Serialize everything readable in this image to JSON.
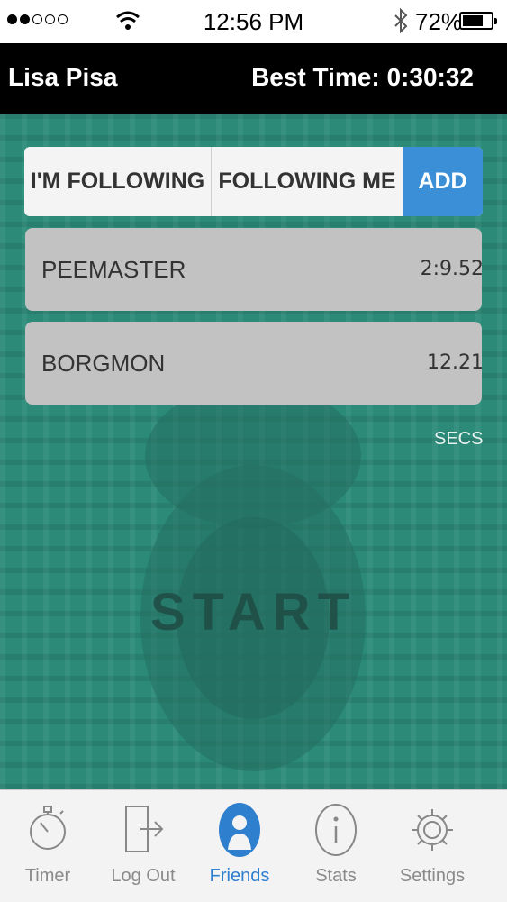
{
  "status_bar": {
    "time": "12:56 PM",
    "battery": "72%",
    "battery_level": 0.72
  },
  "header": {
    "user_name": "Lisa Pisa",
    "best_time": "Best Time: 0:30:32"
  },
  "tabs": {
    "im_following": "I'M FOLLOWING",
    "following_me": "FOLLOWING ME",
    "add": "ADD"
  },
  "friends": [
    {
      "name": "PEEMASTER",
      "time": "2:9.52"
    },
    {
      "name": "BORGMON",
      "time": "12.21"
    }
  ],
  "unit_label": "SECS",
  "start_label": "START",
  "tab_bar": [
    {
      "label": "Timer",
      "icon": "stopwatch-icon"
    },
    {
      "label": "Log Out",
      "icon": "logout-icon"
    },
    {
      "label": "Friends",
      "icon": "person-icon",
      "active": true
    },
    {
      "label": "Stats",
      "icon": "info-icon"
    },
    {
      "label": "Settings",
      "icon": "gear-icon"
    }
  ],
  "colors": {
    "background": "#2b8a78",
    "accent": "#3a8fd6",
    "row": "#c2c2c2",
    "header": "#000000"
  }
}
